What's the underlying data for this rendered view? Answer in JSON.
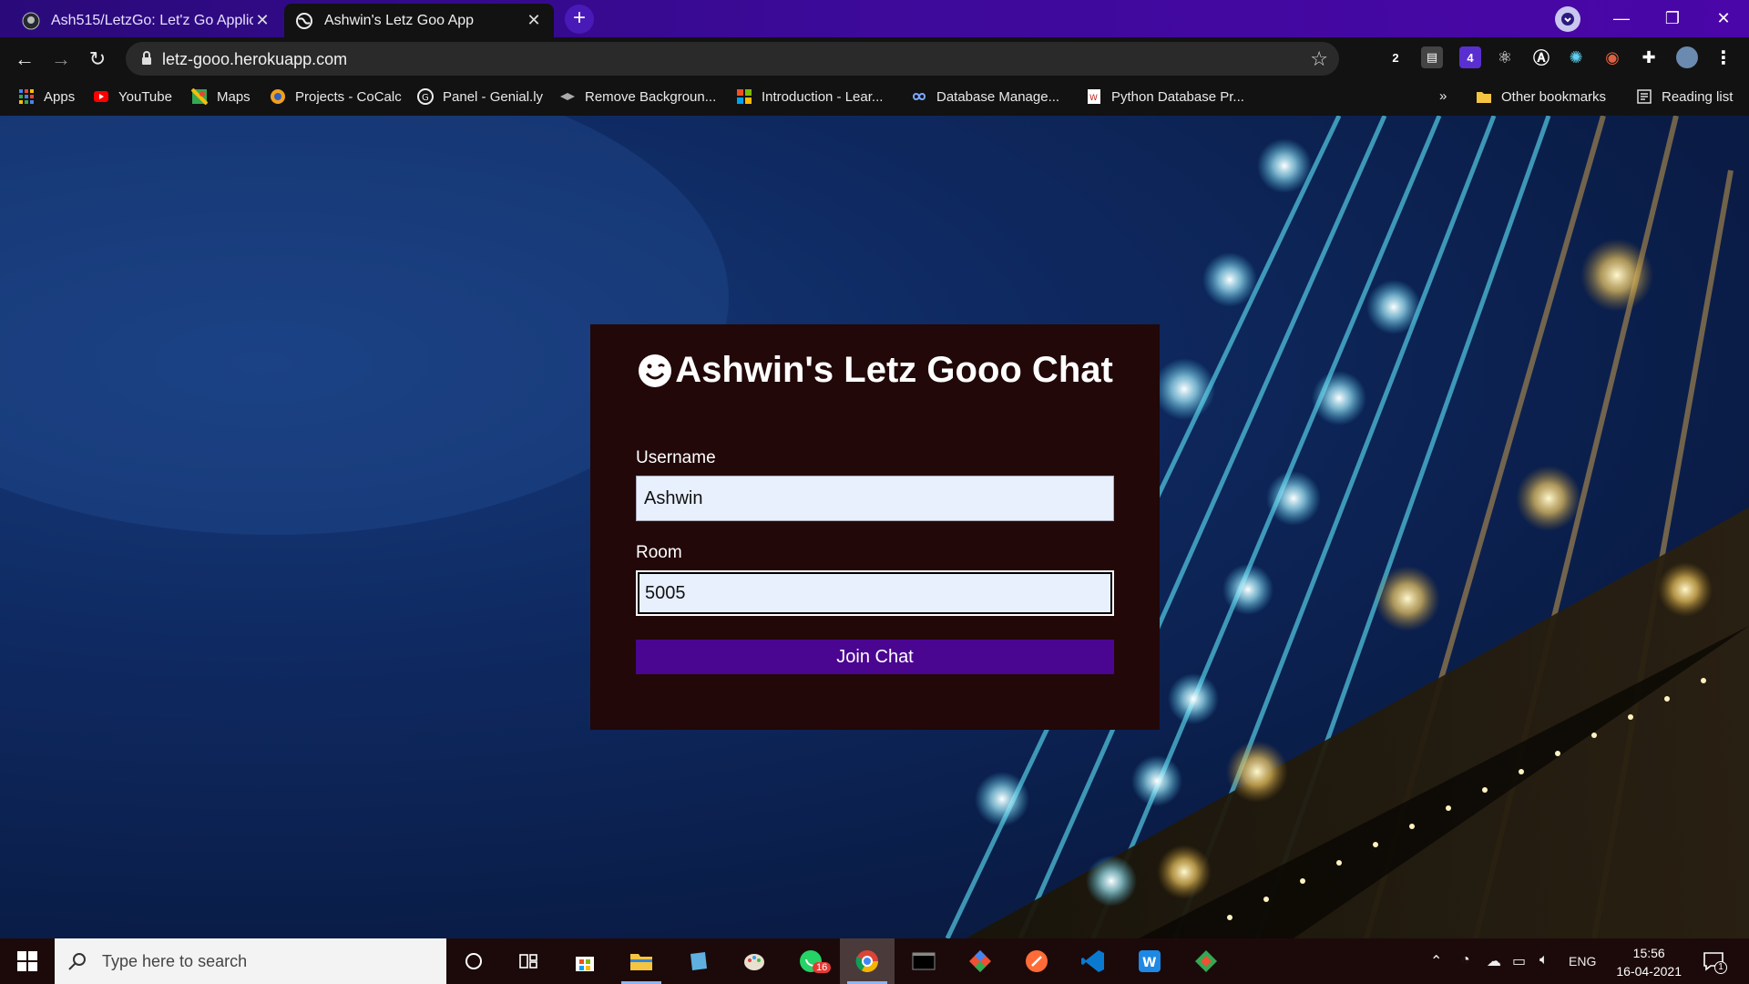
{
  "browser": {
    "tabs": [
      {
        "label": "Ash515/LetzGo: Let'z Go Applicat",
        "close": "✕"
      },
      {
        "label": "Ashwin's Letz Goo App",
        "close": "✕"
      }
    ],
    "new_tab": "+",
    "url": "letz-gooo.herokuapp.com",
    "window_buttons": {
      "minimize": "—",
      "restore": "❐",
      "close": "✕"
    },
    "extensions": [
      {
        "name": "extension-2-icon",
        "text": "2",
        "color": "#1a73e8"
      },
      {
        "name": "extension-card-icon",
        "text": "▤",
        "color": "#555555"
      },
      {
        "name": "extension-cube-icon",
        "text": "4",
        "color": "#5a2fd0"
      },
      {
        "name": "extension-react-icon",
        "text": "⚛",
        "color": "#121212"
      },
      {
        "name": "extension-a-icon",
        "text": "Ⓐ",
        "color": "#121212"
      },
      {
        "name": "extension-gear-icon",
        "text": "✺",
        "color": "#1aa6c8"
      },
      {
        "name": "extension-color-icon",
        "text": "◉",
        "color": "#d04020"
      },
      {
        "name": "extensions-puzzle-icon",
        "text": "✚",
        "color": "#121212"
      }
    ]
  },
  "bookmarks": {
    "items": [
      {
        "label": "Apps",
        "icon": "apps-grid-icon"
      },
      {
        "label": "YouTube",
        "icon": "youtube-icon"
      },
      {
        "label": "Maps",
        "icon": "maps-icon"
      },
      {
        "label": "Projects - CoCalc",
        "icon": "cocalc-icon"
      },
      {
        "label": "Panel - Genial.ly",
        "icon": "genially-icon"
      },
      {
        "label": "Remove Backgroun...",
        "icon": "layers-icon"
      },
      {
        "label": "Introduction - Lear...",
        "icon": "microsoft-icon"
      },
      {
        "label": "Database Manage...",
        "icon": "infinity-icon"
      },
      {
        "label": "Python Database Pr...",
        "icon": "python-doc-icon"
      }
    ],
    "overflow": "»",
    "other": "Other bookmarks",
    "reading_list": "Reading list"
  },
  "card": {
    "title": "Ashwin's Letz Gooo Chat",
    "username_label": "Username",
    "username_value": "Ashwin",
    "room_label": "Room",
    "room_value": "5005",
    "join_label": "Join Chat"
  },
  "taskbar": {
    "search_placeholder": "Type here to search",
    "whatsapp_badge": "16",
    "lang": "ENG",
    "time": "15:56",
    "date": "16-04-2021",
    "notification_count": "1"
  },
  "colors": {
    "accent": "#4a0691",
    "card_bg": "#220808",
    "input_bg": "#e8f0fe"
  }
}
